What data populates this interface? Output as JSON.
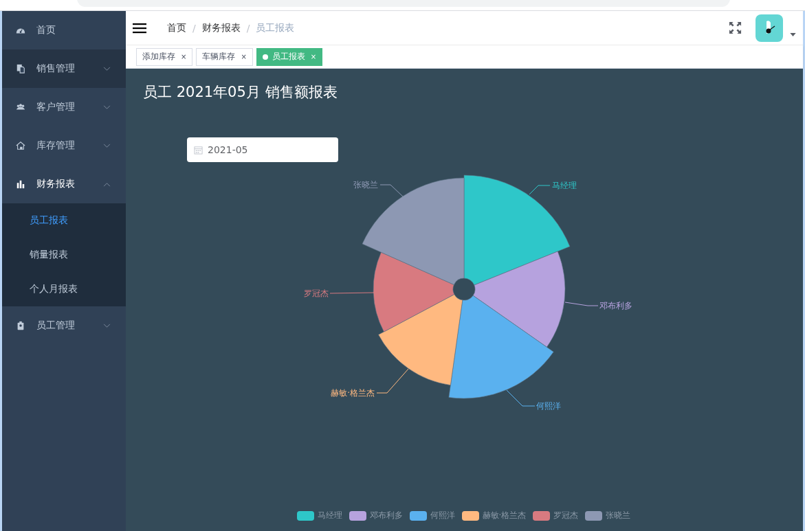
{
  "sidebar": {
    "items": [
      {
        "label": "首页",
        "kind": "link",
        "highlighted": false
      },
      {
        "label": "销售管理",
        "kind": "submenu",
        "expanded": false,
        "highlighted": true
      },
      {
        "label": "客户管理",
        "kind": "submenu",
        "expanded": false,
        "highlighted": false
      },
      {
        "label": "库存管理",
        "kind": "submenu",
        "expanded": false,
        "highlighted": false
      },
      {
        "label": "财务报表",
        "kind": "submenu",
        "expanded": true,
        "highlighted": false,
        "children": [
          {
            "label": "员工报表",
            "selected": true
          },
          {
            "label": "销量报表",
            "selected": false
          },
          {
            "label": "个人月报表",
            "selected": false
          }
        ]
      },
      {
        "label": "员工管理",
        "kind": "submenu",
        "expanded": false,
        "highlighted": false
      }
    ]
  },
  "breadcrumbs": [
    {
      "label": "首页",
      "current": false
    },
    {
      "label": "财务报表",
      "current": false,
      "separator": "/"
    },
    {
      "label": "员工报表",
      "current": true,
      "separator": "/"
    }
  ],
  "tabs": [
    {
      "label": "添加库存",
      "selected": false,
      "close": "×"
    },
    {
      "label": "车辆库存",
      "selected": false,
      "close": "×"
    },
    {
      "label": "员工报表",
      "selected": true,
      "close": "×"
    }
  ],
  "page_title": "员工 2021年05月 销售额报表",
  "date_picker": {
    "value": "2021-05"
  },
  "employees": [
    {
      "name": "马经理",
      "color": "#2ec7c9"
    },
    {
      "name": "邓布利多",
      "color": "#b6a2de"
    },
    {
      "name": "何熙洋",
      "color": "#5ab1ef"
    },
    {
      "name": "赫敏·格兰杰",
      "color": "#ffb980"
    },
    {
      "name": "罗冠杰",
      "color": "#d87a80"
    },
    {
      "name": "张晓兰",
      "color": "#8d98b3"
    }
  ],
  "legend": [
    {
      "name": "马经理",
      "color": "#2ec7c9"
    },
    {
      "name": "邓布利多",
      "color": "#b6a2de"
    },
    {
      "name": "何熙洋",
      "color": "#5ab1ef"
    },
    {
      "name": "赫敏·格兰杰",
      "color": "#ffb980"
    },
    {
      "name": "罗冠杰",
      "color": "#d87a80"
    },
    {
      "name": "张晓兰",
      "color": "#8d98b3"
    }
  ]
}
